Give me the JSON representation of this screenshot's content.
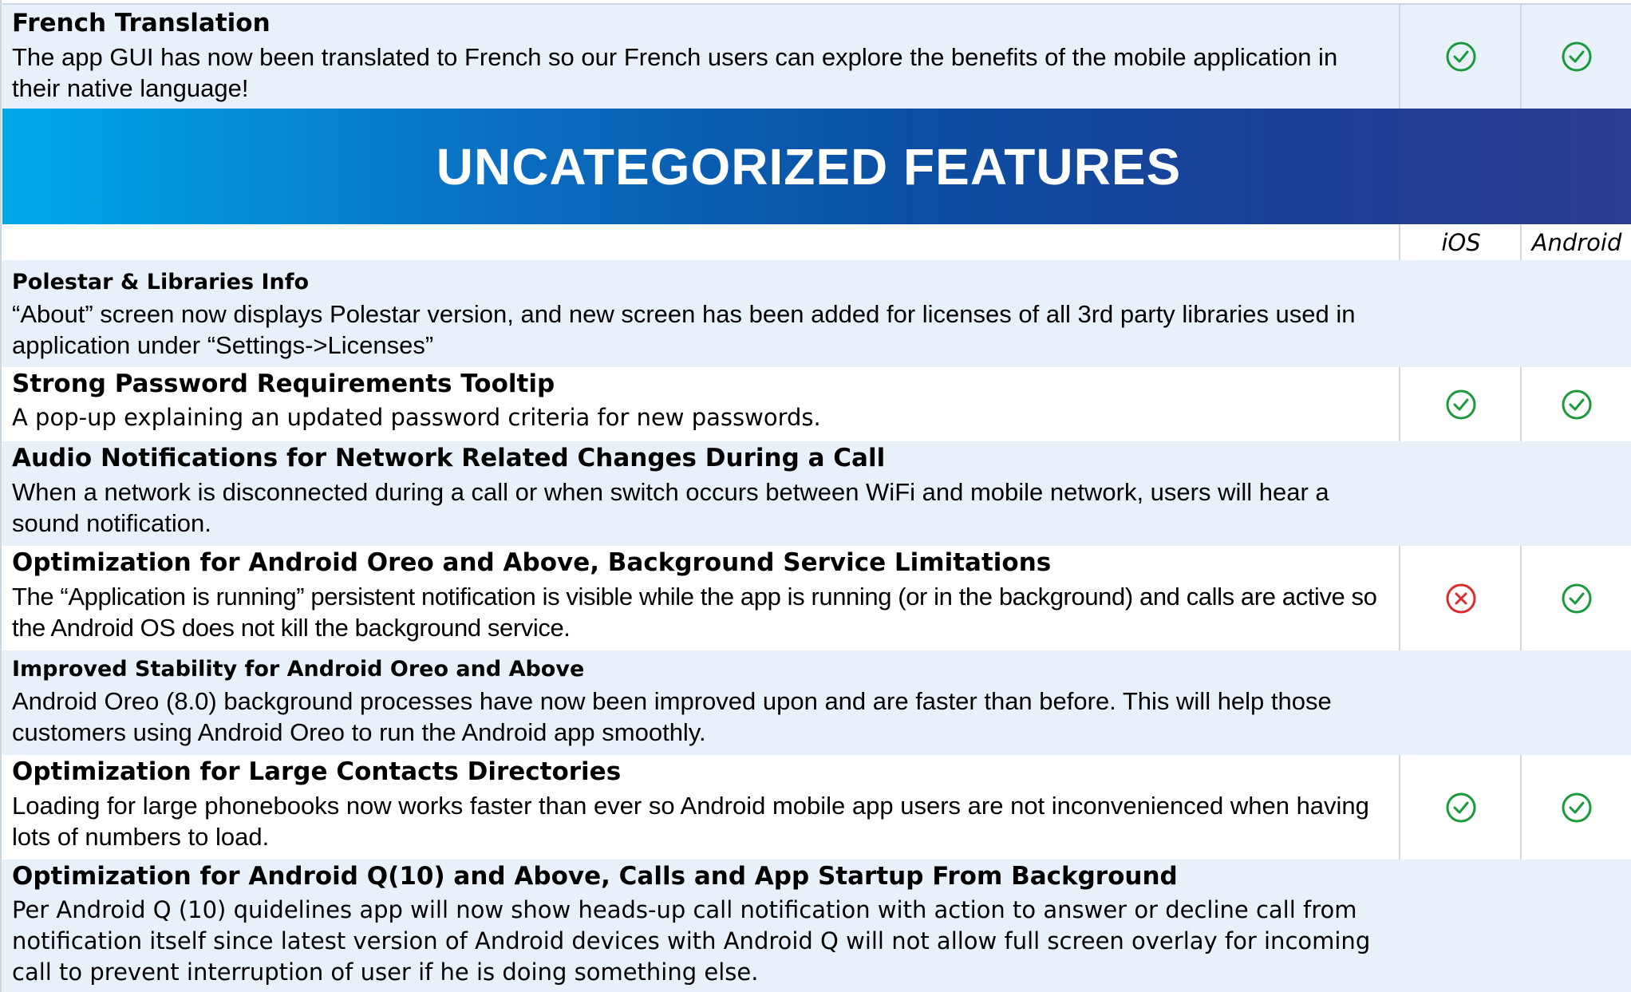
{
  "top_feature": {
    "title": "French Translation",
    "description": "The app GUI has now been translated to French so our French users can explore the benefits of the mobile application in their native language!",
    "ios": "check",
    "android": "check"
  },
  "section": {
    "title": "UNCATEGORIZED FEATURES"
  },
  "columns": {
    "ios": "iOS",
    "android": "Android"
  },
  "features": [
    {
      "title": "Polestar & Libraries Info",
      "description": "“About” screen now displays Polestar version, and new screen has been added for licenses of all 3rd party libraries used in application under “Settings->Licenses”",
      "ios": "",
      "android": ""
    },
    {
      "title": "Strong Password Requirements Tooltip",
      "description": "A pop-up explaining an updated password criteria for new passwords.",
      "ios": "check",
      "android": "check"
    },
    {
      "title": "Audio Notifications for Network Related Changes During a Call",
      "description": "When a network is disconnected during a call or when switch occurs between WiFi and mobile network, users will hear a sound notification.",
      "ios": "",
      "android": ""
    },
    {
      "title": "Optimization for Android Oreo and Above, Background Service Limitations",
      "description": "The “Application is running” persistent notification is visible while the app is running (or in the background) and calls are active so the Android OS does not kill the background service.",
      "ios": "cross",
      "android": "check"
    },
    {
      "title": "Improved Stability for Android Oreo and Above",
      "description": "Android Oreo (8.0) background processes have now been improved upon and are faster than before. This will help those customers using Android Oreo to run the Android app smoothly.",
      "ios": "",
      "android": ""
    },
    {
      "title": "Optimization for Large Contacts Directories",
      "description": "Loading for large phonebooks now works faster than ever so Android mobile app users are not inconvenienced when having lots of numbers to load.",
      "ios": "check",
      "android": "check"
    },
    {
      "title": "Optimization for Android Q(10) and Above, Calls and App Startup From Background",
      "description": "Per Android Q (10) quidelines app will now show heads-up call notification with action to answer or decline call from notification itself since latest version of Android devices with Android Q will not allow full screen overlay for incoming call to prevent interruption of user if he is doing something else.",
      "ios": "",
      "android": ""
    }
  ],
  "colors": {
    "check": "#1a9a3a",
    "cross": "#d92c2c",
    "row_light": "#e8f1fa",
    "banner_start": "#00a9e8",
    "banner_end": "#2c3d92"
  }
}
